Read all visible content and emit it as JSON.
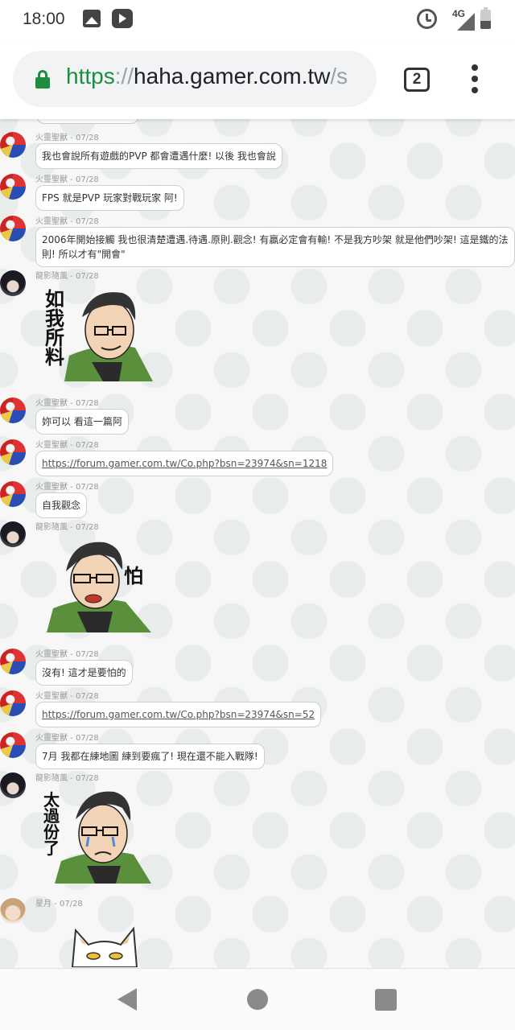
{
  "status_bar": {
    "time": "18:00",
    "network": "4G"
  },
  "browser": {
    "url_scheme": "https",
    "url_separator": "://",
    "url_host": "haha.gamer.com.tw",
    "url_path": "/s",
    "tab_count": "2"
  },
  "messages": [
    {
      "user": "火靈聖獸",
      "date": "07/28",
      "text": "我也會說所有遊戲的PVP 都會遭遇什麼! 以後 我也會說"
    },
    {
      "user": "火靈聖獸",
      "date": "07/28",
      "text": "FPS 就是PVP 玩家對戰玩家 阿!"
    },
    {
      "user": "火靈聖獸",
      "date": "07/28",
      "text": "2006年開始接觸 我也很清楚遭遇.待遇.原則.觀念! 有贏必定會有輸! 不是我方吵架 就是他們吵架! 這是鐵的法則! 所以才有\"開會\""
    },
    {
      "user": "龍影隨風",
      "date": "07/28",
      "sticker_caption": "如我所料"
    },
    {
      "user": "火靈聖獸",
      "date": "07/28",
      "text": "妳可以 看這一篇阿"
    },
    {
      "user": "火靈聖獸",
      "date": "07/28",
      "text": "https://forum.gamer.com.tw/Co.php?bsn=23974&sn=1218"
    },
    {
      "user": "火靈聖獸",
      "date": "07/28",
      "text": "自我觀念"
    },
    {
      "user": "龍影隨風",
      "date": "07/28",
      "sticker_caption": "怕"
    },
    {
      "user": "火靈聖獸",
      "date": "07/28",
      "text": "沒有! 這才是要怕的"
    },
    {
      "user": "火靈聖獸",
      "date": "07/28",
      "text": "https://forum.gamer.com.tw/Co.php?bsn=23974&sn=52"
    },
    {
      "user": "火靈聖獸",
      "date": "07/28",
      "text": "7月 我都在練地圖 練到要瘋了! 現在還不能入戰隊!"
    },
    {
      "user": "龍影隨風",
      "date": "07/28",
      "sticker_caption": "太過份了"
    },
    {
      "user": "星月",
      "date": "07/28"
    }
  ],
  "meta_suffix": " - ",
  "colors": {
    "url_green": "#1e8e3e",
    "chat_bg": "#f7f7f7",
    "bubble_border": "#cfcfcf"
  }
}
